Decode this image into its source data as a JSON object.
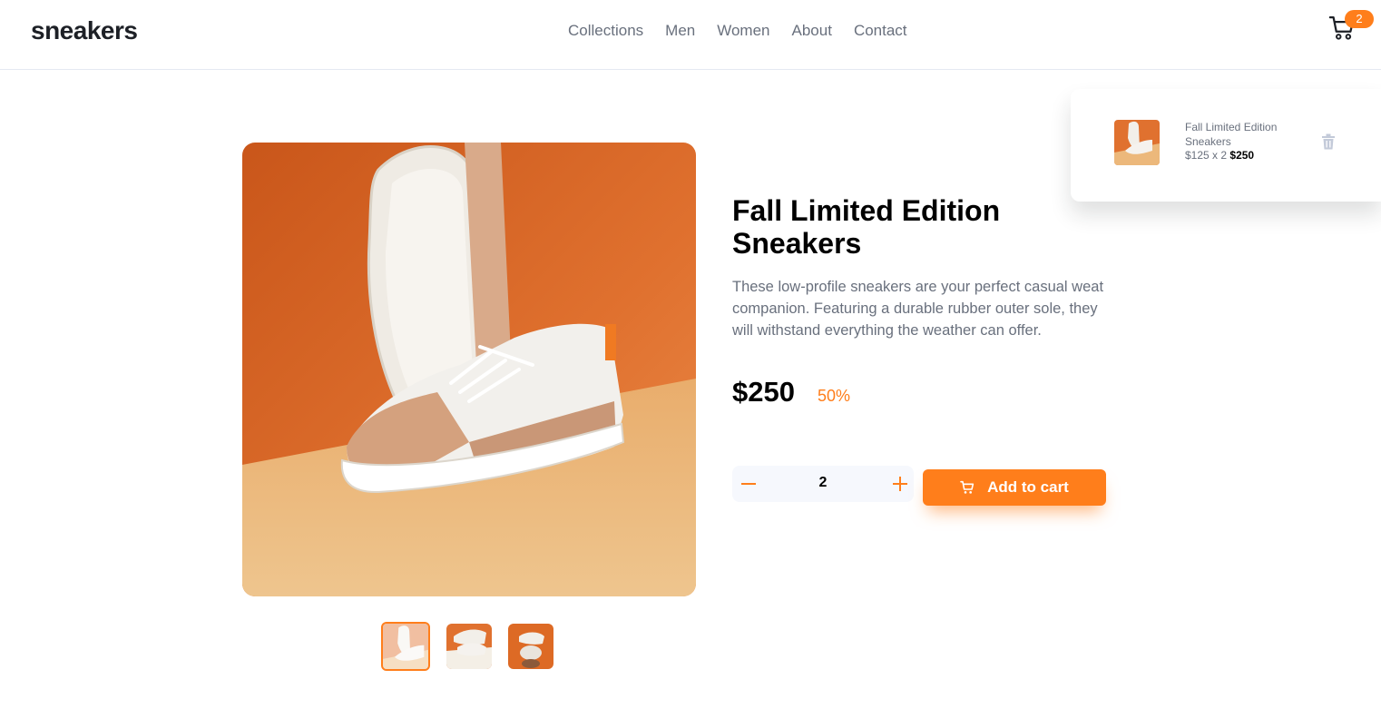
{
  "header": {
    "logo": "sneakers",
    "nav": [
      "Collections",
      "Men",
      "Women",
      "About",
      "Contact"
    ],
    "cart_count": "2",
    "cart_icon": "cart-icon"
  },
  "product": {
    "title": "Fall Limited Edition Sneakers",
    "description": "These low-profile sneakers are your perfect casual weat companion. Featuring a durable rubber outer sole, they will withstand everything the weather can offer.",
    "price": "$250",
    "discount": "50%",
    "quantity": "2",
    "add_to_cart_label": "Add to cart"
  },
  "cart_popup": {
    "item_name": "Fall Limited Edition Sneakers",
    "item_price_qty": "$125 x 2",
    "item_total": "$250"
  },
  "colors": {
    "accent": "#ff7e1b",
    "text_dark": "#1d2026",
    "text_muted": "#69707d",
    "qty_bg": "#f6f8fd"
  }
}
